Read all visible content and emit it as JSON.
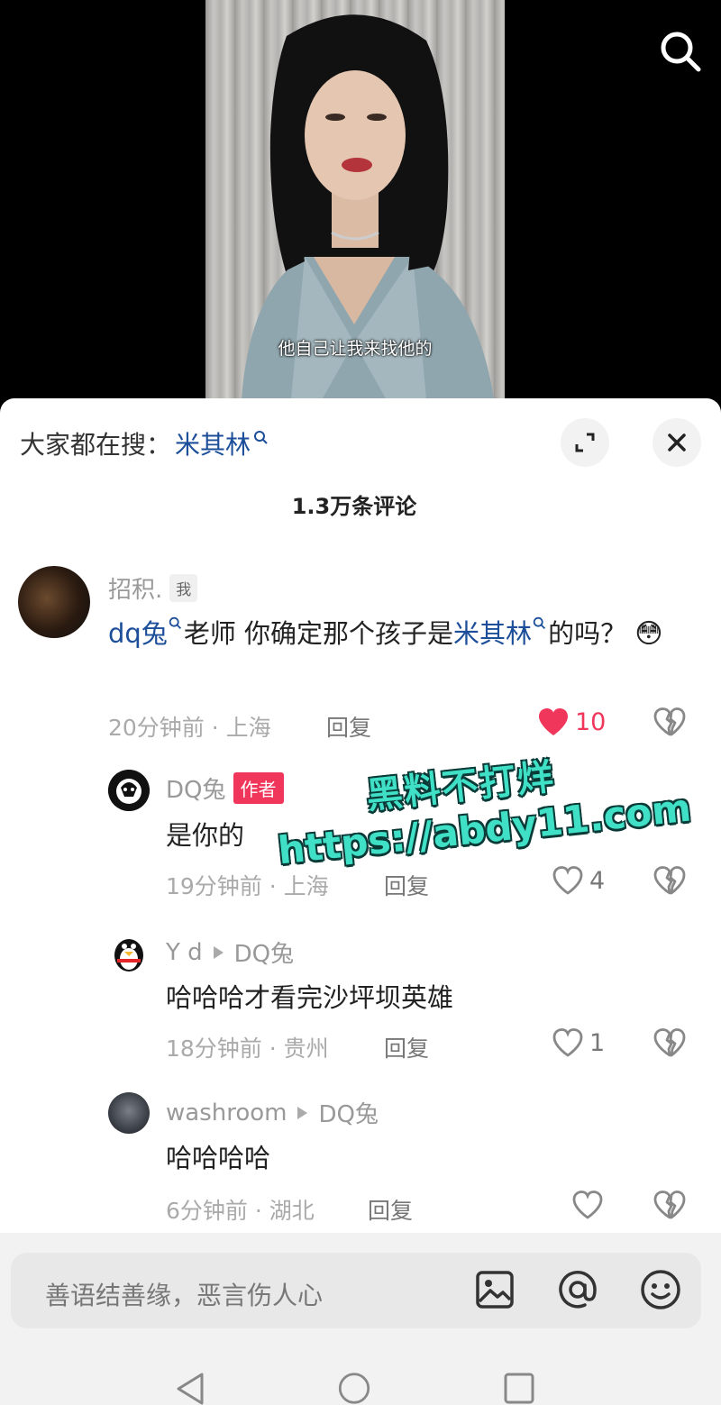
{
  "video": {
    "subtitle": "他自己让我来找他的"
  },
  "sheet": {
    "search_prefix": "大家都在搜：",
    "search_keyword": "米其林",
    "comment_count": "1.3万条评论"
  },
  "comments": [
    {
      "username": "招积.",
      "tag": "我",
      "content_link1": "dq兔",
      "content_mid": "老师  你确定那个孩子是",
      "content_link2": "米其林",
      "content_tail": "的吗？",
      "emoji": "😳",
      "meta": "20分钟前 · 上海",
      "reply": "回复",
      "likes": "10",
      "liked": true
    },
    {
      "username": "DQ兔",
      "tag": "作者",
      "content": "是你的",
      "meta": "19分钟前 · 上海",
      "reply": "回复",
      "likes": "4"
    },
    {
      "username": "Y d",
      "reply_to": "DQ兔",
      "content": "哈哈哈才看完沙坪坝英雄",
      "meta": "18分钟前 · 贵州",
      "reply": "回复",
      "likes": "1"
    },
    {
      "username": "washroom",
      "reply_to": "DQ兔",
      "content": "哈哈哈哈",
      "meta": "6分钟前 · 湖北",
      "reply": "回复",
      "likes": ""
    }
  ],
  "watermark": {
    "line1": "黑料不打烊",
    "line2": "https://abdy11.com"
  },
  "input": {
    "placeholder": "善语结善缘，恶言伤人心"
  },
  "colors": {
    "link": "#1c4e99",
    "like_active": "#f0365a",
    "author_tag": "#f0365a",
    "watermark": "#3fe0c6"
  },
  "icons": [
    "search-icon",
    "expand-icon",
    "close-icon",
    "heart-icon",
    "broken-heart-icon",
    "image-icon",
    "at-icon",
    "emoji-icon",
    "back-icon",
    "home-icon",
    "recents-icon"
  ]
}
